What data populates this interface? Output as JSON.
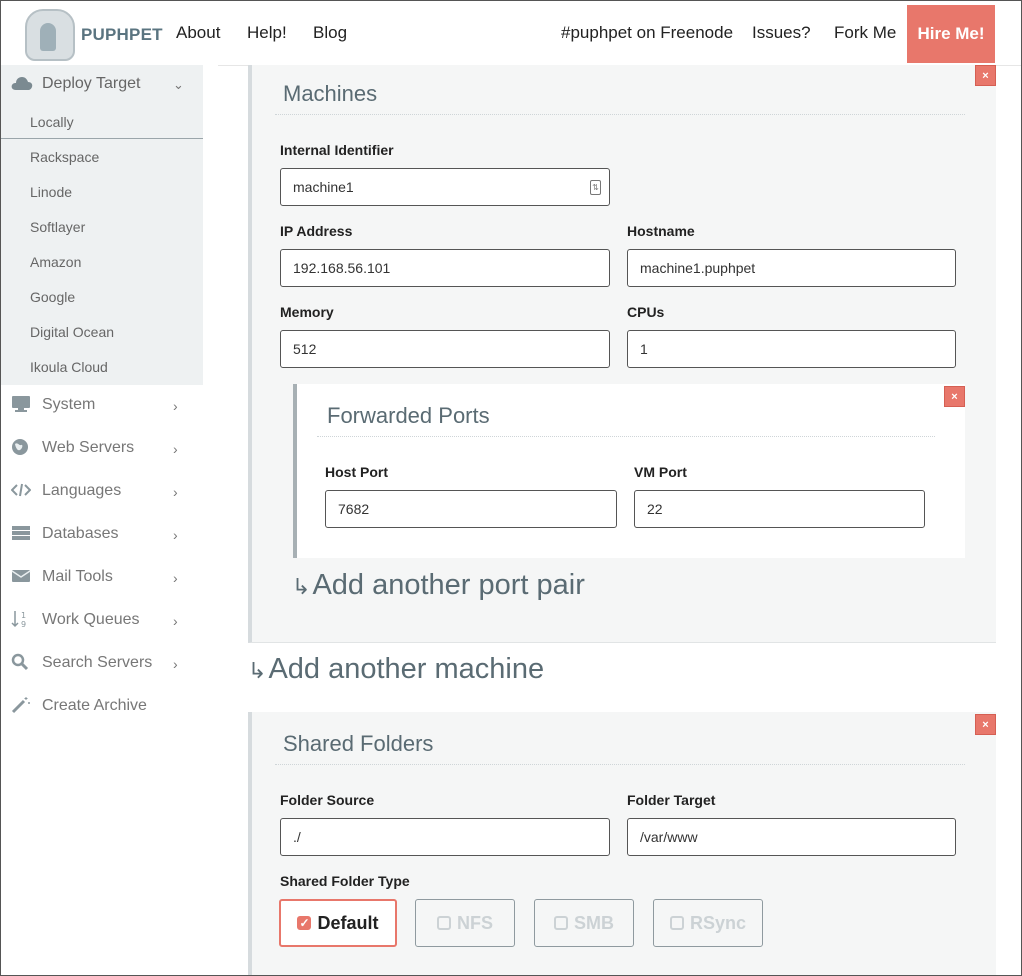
{
  "header": {
    "logo_text": "PUPHPET",
    "nav": [
      {
        "label": "About"
      },
      {
        "label": "Help!"
      },
      {
        "label": "Blog"
      },
      {
        "label": "#puphpet on Freenode"
      },
      {
        "label": "Issues?"
      },
      {
        "label": "Fork Me"
      }
    ],
    "hire_label": "Hire Me!"
  },
  "sidebar": {
    "deploy_target": {
      "label": "Deploy Target",
      "icon": "cloud-icon",
      "items": [
        "Locally",
        "Rackspace",
        "Linode",
        "Softlayer",
        "Amazon",
        "Google",
        "Digital Ocean",
        "Ikoula Cloud"
      ]
    },
    "items": [
      {
        "label": "System",
        "icon": "monitor-icon"
      },
      {
        "label": "Web Servers",
        "icon": "globe-icon"
      },
      {
        "label": "Languages",
        "icon": "code-icon"
      },
      {
        "label": "Databases",
        "icon": "database-icon"
      },
      {
        "label": "Mail Tools",
        "icon": "envelope-icon"
      },
      {
        "label": "Work Queues",
        "icon": "sort-numeric-icon"
      },
      {
        "label": "Search Servers",
        "icon": "search-icon"
      },
      {
        "label": "Create Archive",
        "icon": "magic-wand-icon"
      }
    ]
  },
  "machines": {
    "title": "Machines",
    "close": "×",
    "internal_identifier": {
      "label": "Internal Identifier",
      "value": "machine1"
    },
    "ip_address": {
      "label": "IP Address",
      "value": "192.168.56.101"
    },
    "hostname": {
      "label": "Hostname",
      "value": "machine1.puphpet"
    },
    "memory": {
      "label": "Memory",
      "value": "512"
    },
    "cpus": {
      "label": "CPUs",
      "value": "1"
    },
    "forwarded_ports": {
      "title": "Forwarded Ports",
      "close": "×",
      "host_port": {
        "label": "Host Port",
        "value": "7682"
      },
      "vm_port": {
        "label": "VM Port",
        "value": "22"
      }
    },
    "add_port_pair": "Add another port pair"
  },
  "add_machine": "Add another machine",
  "shared_folders": {
    "title": "Shared Folders",
    "close": "×",
    "folder_source": {
      "label": "Folder Source",
      "value": "./"
    },
    "folder_target": {
      "label": "Folder Target",
      "value": "/var/www"
    },
    "type_label": "Shared Folder Type",
    "types": [
      {
        "label": "Default",
        "checked": true
      },
      {
        "label": "NFS",
        "checked": false
      },
      {
        "label": "SMB",
        "checked": false
      },
      {
        "label": "RSync",
        "checked": false
      }
    ]
  },
  "colors": {
    "accent": "#e8776b",
    "panel_bg": "#f5f6f6",
    "sidebar_active_bg": "#eef1f2",
    "title_text": "#5a6b73"
  }
}
